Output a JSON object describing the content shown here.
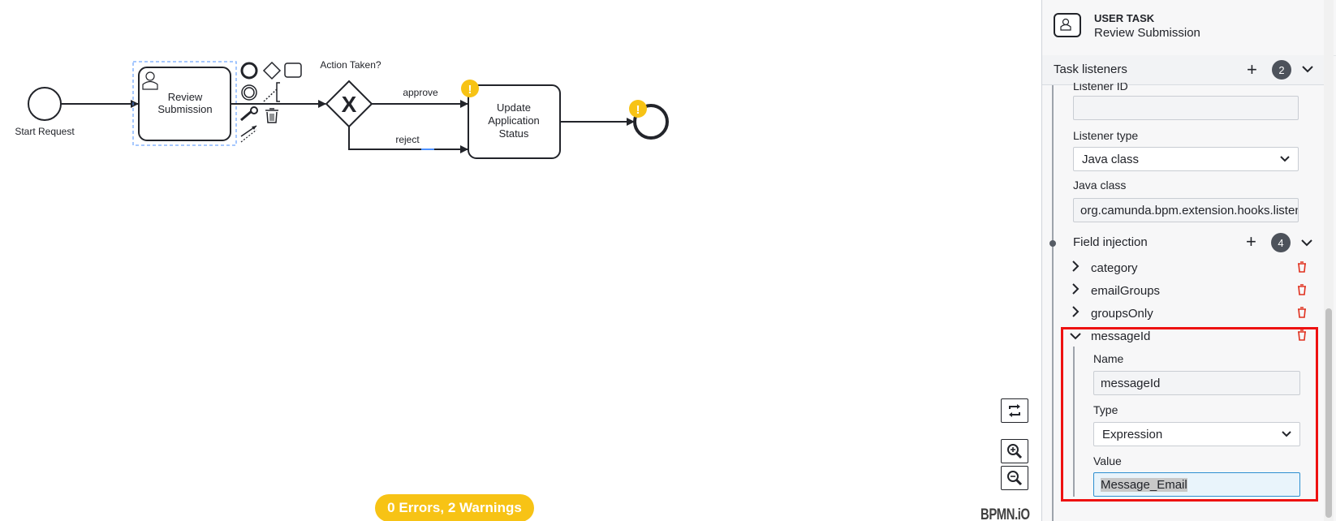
{
  "diagram": {
    "start_label": "Start Request",
    "task1_label_line1": "Review",
    "task1_label_line2": "Submission",
    "gateway_label": "Action Taken?",
    "gateway_symbol": "X",
    "flow_approve": "approve",
    "flow_reject": "reject",
    "task2_line1": "Update",
    "task2_line2": "Application",
    "task2_line3": "Status",
    "warning_symbol": "!"
  },
  "canvas": {
    "issues_badge": "0 Errors, 2 Warnings",
    "watermark": "BPMN.iO"
  },
  "panel": {
    "element_type": "USER TASK",
    "element_name": "Review Submission",
    "group_title": "Task listeners",
    "group_count": "2",
    "listener_id_label": "Listener ID",
    "listener_id_value": "",
    "listener_type_label": "Listener type",
    "listener_type_value": "Java class",
    "java_class_label": "Java class",
    "java_class_value": "org.camunda.bpm.extension.hooks.listeners",
    "field_injection_label": "Field injection",
    "field_injection_count": "4",
    "fields": [
      "category",
      "emailGroups",
      "groupsOnly",
      "messageId"
    ],
    "expanded_field": {
      "name_label": "Name",
      "name_value": "messageId",
      "type_label": "Type",
      "type_value": "Expression",
      "value_label": "Value",
      "value_value": "Message_Email"
    }
  },
  "colors": {
    "warning": "#f7c315",
    "delete": "#e0301e",
    "highlight": "#ee1111",
    "selection": "#4d90fe"
  }
}
